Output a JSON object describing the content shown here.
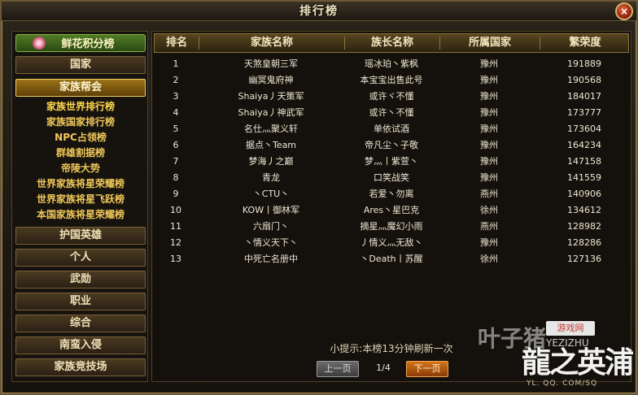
{
  "window": {
    "title": "排行榜"
  },
  "close": {
    "glyph": "×"
  },
  "sidebar": {
    "header": "鲜花积分榜",
    "buttons": {
      "country": "国家",
      "family": "家族帮会",
      "guard": "护国英雄",
      "personal": "个人",
      "merit": "武勋",
      "job": "职业",
      "overall": "综合",
      "invasion": "南蛮入侵",
      "arena": "家族竞技场"
    },
    "sub_items": [
      "家族世界排行榜",
      "家族国家排行榜",
      "NPC占领榜",
      "群雄割据榜",
      "帝陵大势",
      "世界家族将星荣耀榜",
      "世界家族将星飞跃榜",
      "本国家族将星荣耀榜"
    ]
  },
  "table": {
    "headers": [
      "排名",
      "家族名称",
      "族长名称",
      "所属国家",
      "繁荣度"
    ],
    "rows": [
      [
        "1",
        "天煞皇朝三军",
        "瑶冰珀丶紫枫",
        "豫州",
        "191889"
      ],
      [
        "2",
        "幽冥鬼府神",
        "本宝宝出售此号",
        "豫州",
        "190568"
      ],
      [
        "3",
        "Shaiya丿天策军",
        "或许ヾ不懂",
        "豫州",
        "184017"
      ],
      [
        "4",
        "Shaiya丿神武军",
        "或许丶不懂",
        "豫州",
        "173777"
      ],
      [
        "5",
        "名仕灬聚义轩",
        "单依试酒",
        "豫州",
        "173604"
      ],
      [
        "6",
        "据点丶Team",
        "帝凡尘丶子敬",
        "豫州",
        "164234"
      ],
      [
        "7",
        "梦海丿之巅",
        "梦灬丨紫萱丶",
        "豫州",
        "147158"
      ],
      [
        "8",
        "青龙",
        "口笑战笑",
        "豫州",
        "141559"
      ],
      [
        "9",
        "丶CTU丶",
        "若爱丶勿离",
        "燕州",
        "140906"
      ],
      [
        "10",
        "KOW丨御林军",
        "Ares丶星巴克",
        "徐州",
        "134612"
      ],
      [
        "11",
        "六扇门丶",
        "摘星灬魔幻小雨",
        "燕州",
        "128982"
      ],
      [
        "12",
        "丶情义天下丶",
        "丿情义灬无敌丶",
        "豫州",
        "128286"
      ],
      [
        "13",
        "中死亡名册中",
        "丶Death丨苏醒",
        "徐州",
        "127136"
      ]
    ]
  },
  "footer": {
    "hint": "小提示:本榜13分钟刷新一次",
    "prev": "上一页",
    "page": "1/4",
    "next": "下一页"
  },
  "watermark": {
    "left": "叶子猪",
    "badge": "游戏网",
    "mid": "YEZIZHU",
    "big": "龍之英浦",
    "url": "YL. QQ. COM/SQ"
  }
}
